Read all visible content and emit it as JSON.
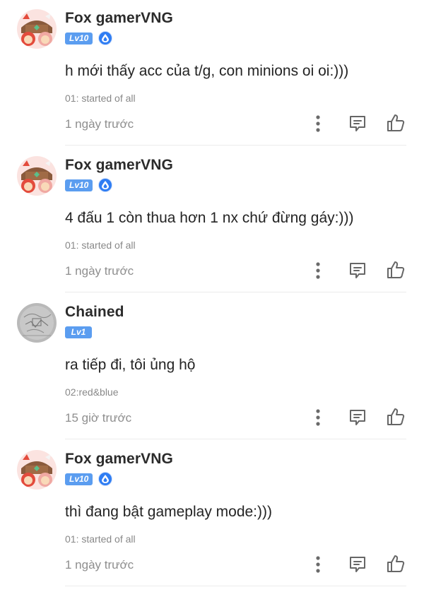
{
  "comments": [
    {
      "username": "Fox gamerVNG",
      "level": "Lv10",
      "has_gem_badge": true,
      "avatar": "fox-character-avatar",
      "text": "h mới thấy acc của t/g, con minions oi oi:)))",
      "flair": "01: started of all",
      "time": "1 ngày trước"
    },
    {
      "username": "Fox gamerVNG",
      "level": "Lv10",
      "has_gem_badge": true,
      "avatar": "fox-character-avatar",
      "text": "4 đấu 1 còn thua hơn 1 nx chứ đừng gáy:)))",
      "flair": "01: started of all",
      "time": "1 ngày trước"
    },
    {
      "username": "Chained",
      "level": "Lv1",
      "has_gem_badge": false,
      "avatar": "grey-sketch-avatar",
      "text": "ra tiếp đi, tôi ủng hộ",
      "flair": "02:red&blue",
      "time": "15 giờ trước"
    },
    {
      "username": "Fox gamerVNG",
      "level": "Lv10",
      "has_gem_badge": true,
      "avatar": "fox-character-avatar",
      "text": "thì đang bật gameplay mode:)))",
      "flair": "01: started of all",
      "time": "1 ngày trước"
    }
  ],
  "icons": {
    "more": "more-vertical-icon",
    "reply": "comment-reply-icon",
    "like": "thumbs-up-icon",
    "gem": "water-drop-gem-icon"
  },
  "colors": {
    "level_badge": "#5b9df0",
    "gem_badge": "#2f7df3",
    "username": "#2b2b2b",
    "meta_text": "#8e8e8e"
  }
}
